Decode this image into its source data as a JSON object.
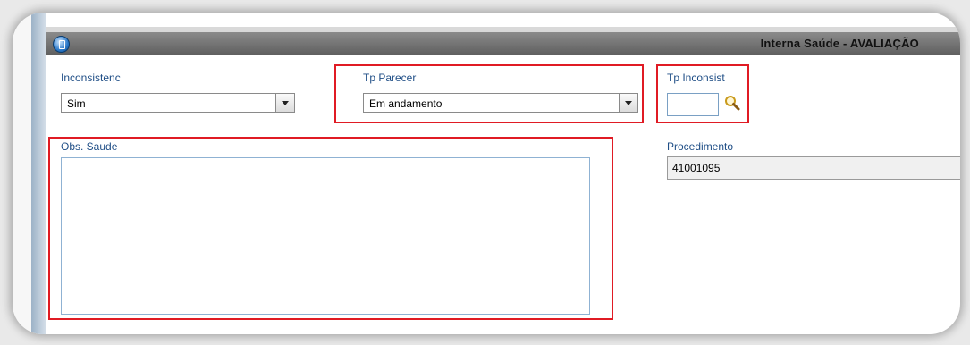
{
  "window": {
    "title": "Interna Saúde - AVALIAÇÃO"
  },
  "fields": {
    "inconsistenc": {
      "label": "Inconsistenc",
      "value": "Sim"
    },
    "tp_parecer": {
      "label": "Tp Parecer",
      "value": "Em andamento"
    },
    "tp_inconsist": {
      "label": "Tp Inconsist",
      "value": ""
    },
    "obs_saude": {
      "label": "Obs. Saude",
      "value": ""
    },
    "procedimento": {
      "label": "Procedimento",
      "value": "41001095"
    }
  },
  "colors": {
    "label_text": "#1f4e86",
    "highlight": "#e01b24",
    "titlebar": "#6f6f6f"
  },
  "icons": {
    "window": "app-icon",
    "lookup": "magnifier-icon",
    "dropdown": "chevron-down-icon"
  }
}
